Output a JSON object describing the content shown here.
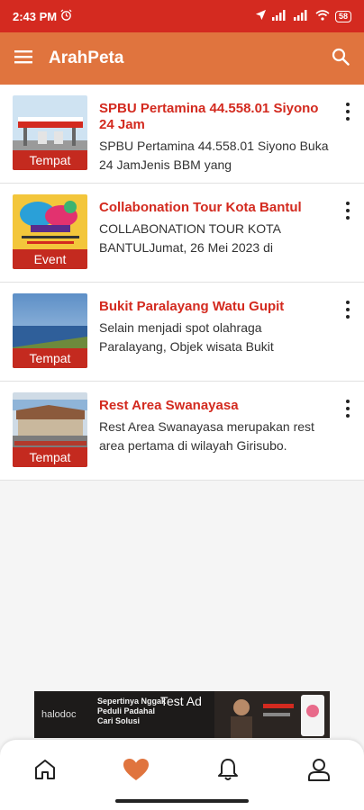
{
  "status_bar": {
    "time": "2:43 PM",
    "battery": "58"
  },
  "app_bar": {
    "title": "ArahPeta",
    "menu_icon": "hamburger-menu-icon",
    "search_icon": "search-icon"
  },
  "items": [
    {
      "title": "SPBU Pertamina 44.558.01 Siyono 24 Jam",
      "description": "SPBU Pertamina 44.558.01 Siyono Buka 24 JamJenis BBM yang",
      "tag": "Tempat"
    },
    {
      "title": "Collabonation Tour Kota Bantul",
      "description": "COLLABONATION TOUR KOTA BANTULJumat, 26 Mei 2023 di",
      "tag": "Event"
    },
    {
      "title": "Bukit Paralayang Watu Gupit",
      "description": "Selain menjadi spot olahraga Paralayang, Objek wisata Bukit",
      "tag": "Tempat"
    },
    {
      "title": "Rest Area Swanayasa",
      "description": "Rest Area Swanayasa merupakan rest area pertama di wilayah Girisubo.",
      "tag": "Tempat"
    }
  ],
  "ad": {
    "label": "Test Ad",
    "brand": "halodoc",
    "copy": "Sepertinya Nggak Peduli Padahal Cari Solusi"
  },
  "bottom_nav": [
    {
      "icon": "home-icon"
    },
    {
      "icon": "heart-icon"
    },
    {
      "icon": "bell-icon"
    },
    {
      "icon": "user-icon"
    }
  ],
  "colors": {
    "status_bar": "#d42a20",
    "app_bar": "#e0743e",
    "title_red": "#d32a1f",
    "tag_red": "#c42a1f",
    "active_nav": "#e0743e"
  }
}
